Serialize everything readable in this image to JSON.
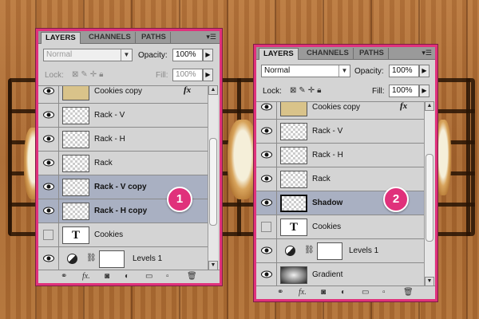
{
  "colors": {
    "accent": "#e0317b",
    "wood": "#a6652e",
    "panel_bg": "#d4d4d4",
    "selected_row": "#a9b0c2"
  },
  "panels": [
    {
      "tabs": [
        "LAYERS",
        "CHANNELS",
        "PATHS"
      ],
      "menu_icon": "panel-menu-icon",
      "blend_mode": "Normal",
      "opacity_label": "Opacity:",
      "opacity_value": "100%",
      "lock_label": "Lock:",
      "fill_label": "Fill:",
      "fill_value": "100%",
      "layers": [
        {
          "name": "Cookies copy",
          "fx": "fx",
          "visible": true,
          "thumb": "pattern",
          "selected": false
        },
        {
          "name": "Rack - V",
          "visible": true,
          "thumb": "checker",
          "selected": false
        },
        {
          "name": "Rack - H",
          "visible": true,
          "thumb": "checker",
          "selected": false
        },
        {
          "name": "Rack",
          "visible": true,
          "thumb": "checker",
          "selected": false
        },
        {
          "name": "Rack - V copy",
          "visible": true,
          "thumb": "checker",
          "selected": true
        },
        {
          "name": "Rack - H copy",
          "visible": true,
          "thumb": "checker",
          "selected": true
        },
        {
          "name": "Cookies",
          "visible": false,
          "thumb": "text",
          "thumb_glyph": "T",
          "selected": false
        },
        {
          "name": "Levels 1",
          "visible": true,
          "thumb": "white",
          "adjustment": true,
          "selected": false
        }
      ],
      "badge": "1"
    },
    {
      "tabs": [
        "LAYERS",
        "CHANNELS",
        "PATHS"
      ],
      "menu_icon": "panel-menu-icon",
      "blend_mode": "Normal",
      "opacity_label": "Opacity:",
      "opacity_value": "100%",
      "lock_label": "Lock:",
      "fill_label": "Fill:",
      "fill_value": "100%",
      "layers": [
        {
          "name": "Cookies copy",
          "fx": "fx",
          "visible": true,
          "thumb": "pattern",
          "selected": false
        },
        {
          "name": "Rack - V",
          "visible": true,
          "thumb": "checker",
          "selected": false
        },
        {
          "name": "Rack - H",
          "visible": true,
          "thumb": "checker",
          "selected": false
        },
        {
          "name": "Rack",
          "visible": true,
          "thumb": "checker",
          "selected": false
        },
        {
          "name": "Shadow",
          "visible": true,
          "thumb": "checker",
          "selected": true
        },
        {
          "name": "Cookies",
          "visible": false,
          "thumb": "text",
          "thumb_glyph": "T",
          "selected": false
        },
        {
          "name": "Levels 1",
          "visible": true,
          "thumb": "white",
          "adjustment": true,
          "selected": false
        },
        {
          "name": "Gradient",
          "visible": true,
          "thumb": "gradient",
          "selected": false
        }
      ],
      "badge": "2"
    }
  ],
  "bottom_icons": [
    "link-layers-icon",
    "fx-icon",
    "layer-mask-icon",
    "adjustment-layer-icon",
    "new-group-icon",
    "new-layer-icon",
    "trash-icon"
  ],
  "bottom_fx": "fx."
}
